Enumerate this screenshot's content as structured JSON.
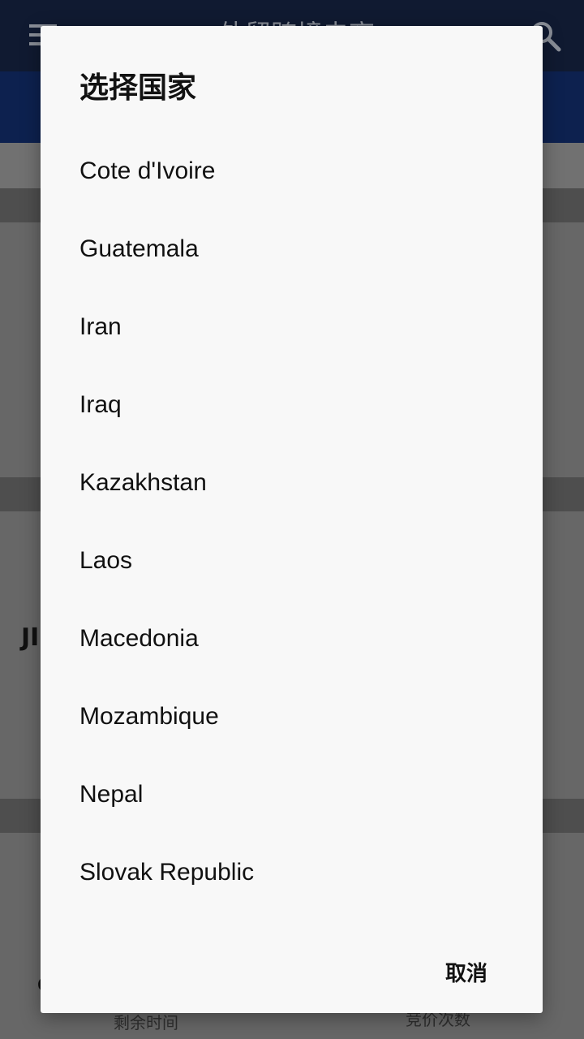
{
  "app": {
    "title": "外贸跨境电商"
  },
  "background": {
    "card_letter": "JI",
    "small_letter": "C",
    "footer": {
      "time_left_label": "剩余时间",
      "bid_count_label": "竞价次数"
    }
  },
  "dialog": {
    "title": "选择国家",
    "items": [
      "Cote d'Ivoire",
      "Guatemala",
      "Iran",
      "Iraq",
      "Kazakhstan",
      "Laos",
      "Macedonia",
      "Mozambique",
      "Nepal",
      "Slovak Republic"
    ],
    "cancel_label": "取消"
  }
}
